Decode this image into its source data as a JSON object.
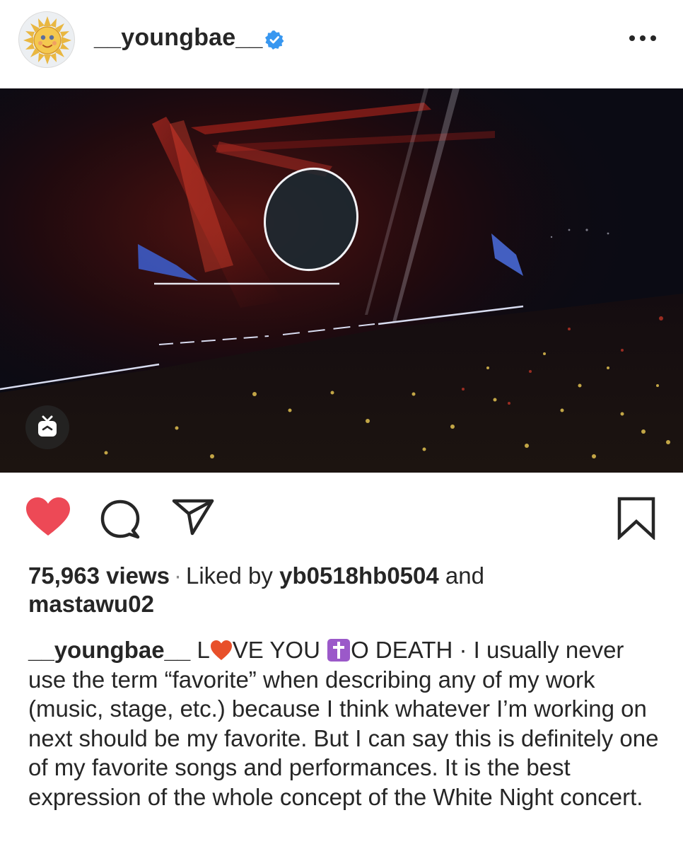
{
  "post": {
    "username": "__youngbae__",
    "verified": true,
    "icons": {
      "avatar": "sun-face-avatar",
      "verified": "verified-badge-icon",
      "more": "more-options-icon",
      "igtv": "igtv-icon",
      "like": "heart-filled-icon",
      "comment": "comment-icon",
      "share": "share-icon",
      "save": "bookmark-icon"
    },
    "colors": {
      "like": "#ed4956",
      "verified": "#3897f0",
      "text": "#262626",
      "secondary": "#8e8e8e"
    }
  },
  "stats": {
    "views": "75,963 views",
    "separator": "·",
    "liked_by_prefix": "Liked by",
    "liked_user": "yb0518hb0504",
    "and": "and",
    "second_user": "mastawu02"
  },
  "caption": {
    "username": "__youngbae__",
    "part1": "L",
    "part2": "VE YOU",
    "part3": "O DEATH · I usually never use the term “favorite” when describing any of my work (music, stage, etc.) because I think whatever I’m working on next should be my favorite. But I can say this is definitely one of my favorite songs and performances. It is the best expression of the whole concept of the White Night concert.",
    "emoji1": "red-heart-emoji",
    "emoji2": "latin-cross-emoji"
  }
}
